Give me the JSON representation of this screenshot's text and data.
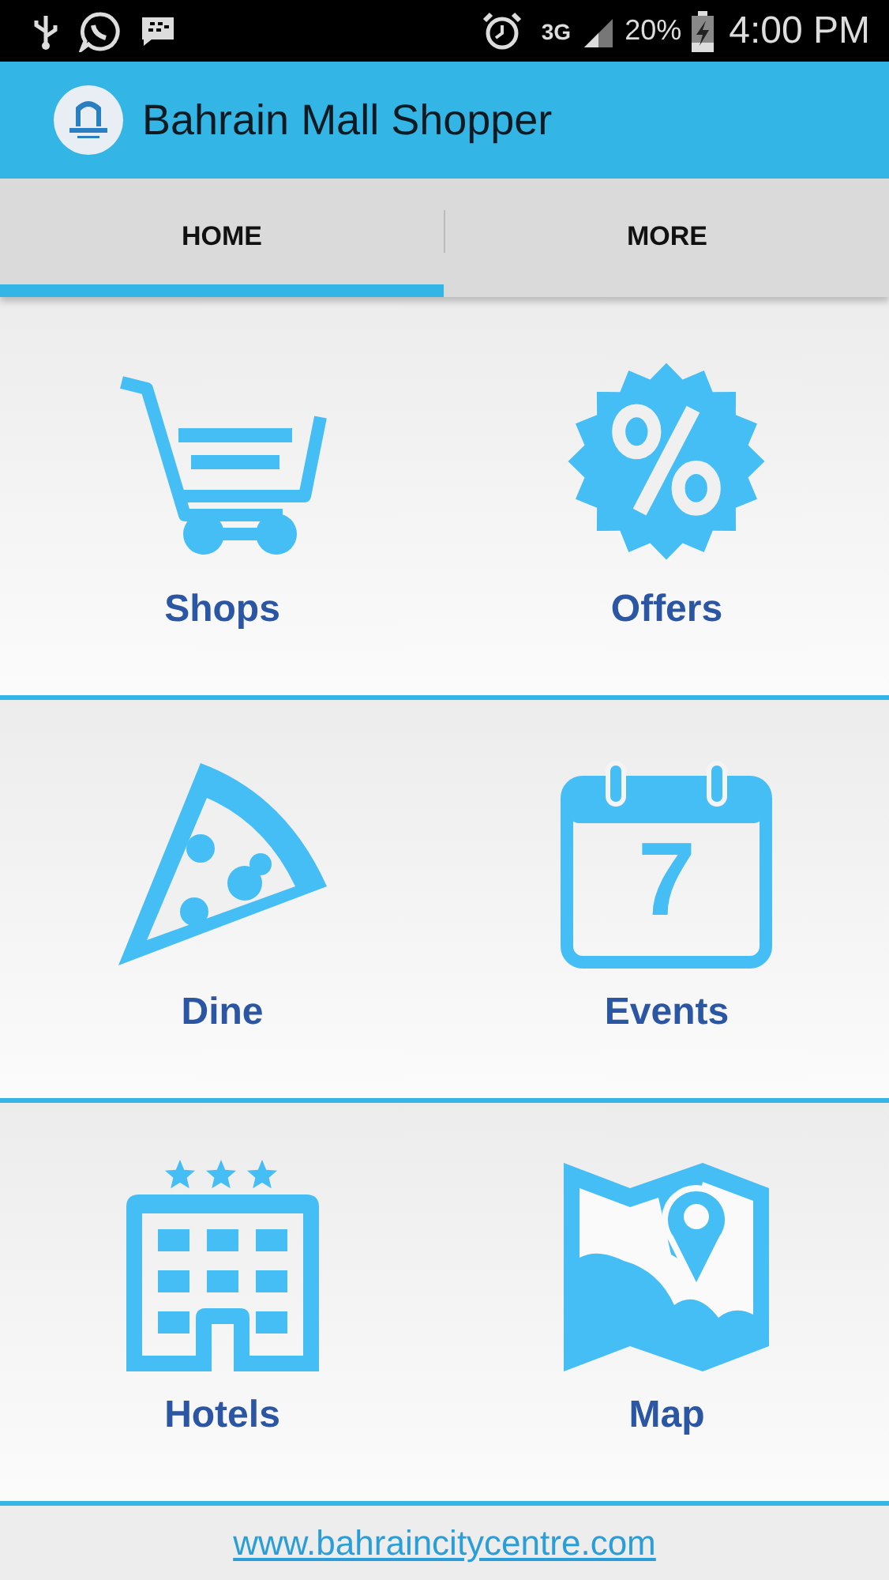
{
  "status_bar": {
    "network": "3G",
    "battery": "20%",
    "time": "4:00 PM"
  },
  "app_bar": {
    "title": "Bahrain Mall Shopper"
  },
  "tabs": [
    {
      "label": "HOME",
      "selected": true
    },
    {
      "label": "MORE",
      "selected": false
    }
  ],
  "tiles": [
    {
      "kind": "cart",
      "label": "Shops"
    },
    {
      "kind": "badge",
      "label": "Offers"
    },
    {
      "kind": "pizza",
      "label": "Dine"
    },
    {
      "kind": "calendar",
      "label": "Events"
    },
    {
      "kind": "hotel",
      "label": "Hotels"
    },
    {
      "kind": "map",
      "label": "Map"
    }
  ],
  "calendar_icon": {
    "day": "7"
  },
  "footer": {
    "link": "www.bahraincitycentre.com"
  }
}
